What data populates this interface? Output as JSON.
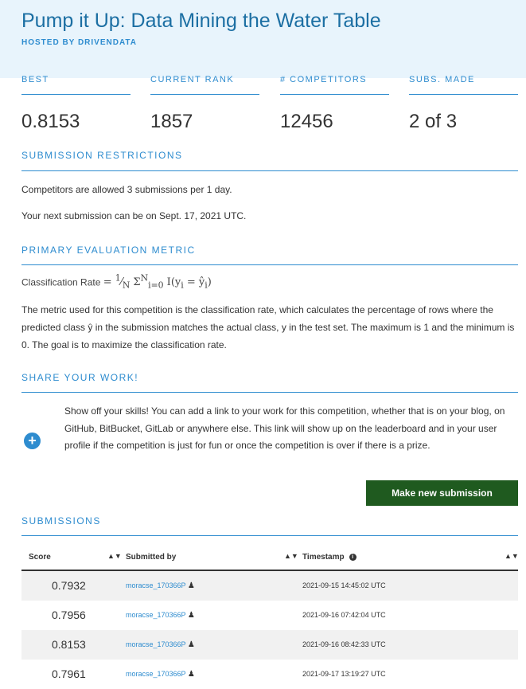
{
  "header": {
    "title": "Pump it Up: Data Mining the Water Table",
    "hosted_by": "HOSTED BY DRIVENDATA"
  },
  "stats": [
    {
      "label": "BEST",
      "value": "0.8153"
    },
    {
      "label": "CURRENT RANK",
      "value": "1857"
    },
    {
      "label": "# COMPETITORS",
      "value": "12456"
    },
    {
      "label": "SUBS. MADE",
      "value": "2 of 3"
    }
  ],
  "restrictions": {
    "title": "SUBMISSION RESTRICTIONS",
    "line1": "Competitors are allowed 3 submissions per 1 day.",
    "line2": "Your next submission can be on Sept. 17, 2021 UTC."
  },
  "metric": {
    "title": "PRIMARY EVALUATION METRIC",
    "formula_label": "Classification Rate",
    "description": "The metric used for this competition is the classification rate, which calculates the percentage of rows where the predicted class ŷ in the submission matches the actual class, y in the test set. The maximum is 1 and the minimum is 0. The goal is to maximize the classification rate."
  },
  "share": {
    "title": "SHARE YOUR WORK!",
    "text": "Show off your skills! You can add a link to your work for this competition, whether that is on your blog, on GitHub, BitBucket, GitLab or anywhere else. This link will show up on the leaderboard and in your user profile if the competition is just for fun or once the competition is over if there is a prize."
  },
  "new_submission_button": "Make new submission",
  "submissions": {
    "title": "SUBMISSIONS",
    "columns": {
      "score": "Score",
      "submitted_by": "Submitted by",
      "timestamp": "Timestamp"
    },
    "rows": [
      {
        "score": "0.7932",
        "user": "moracse_170366P",
        "timestamp": "2021-09-15 14:45:02 UTC"
      },
      {
        "score": "0.7956",
        "user": "moracse_170366P",
        "timestamp": "2021-09-16 07:42:04 UTC"
      },
      {
        "score": "0.8153",
        "user": "moracse_170366P",
        "timestamp": "2021-09-16 08:42:33 UTC"
      },
      {
        "score": "0.7961",
        "user": "moracse_170366P",
        "timestamp": "2021-09-17 13:19:27 UTC"
      }
    ]
  },
  "colors": {
    "accent": "#2e8ccf",
    "header_bg": "#e8f4fc",
    "button_bg": "#1f5a1f"
  },
  "icons": {
    "share": "plus-circle-icon",
    "sort": "sort-icon",
    "info": "info-icon",
    "user": "person-icon"
  }
}
